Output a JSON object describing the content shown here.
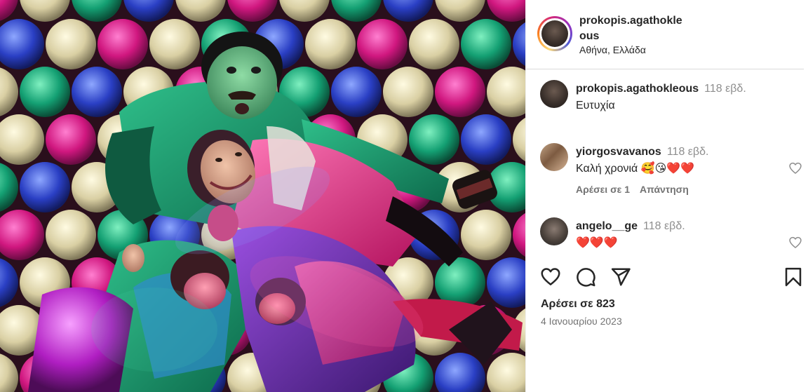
{
  "post": {
    "author": "prokopis.agathokleous",
    "author_line1": "prokopis.agathokle",
    "author_line2": "ous",
    "location": "Αθήνα, Ελλάδα"
  },
  "caption": {
    "user": "prokopis.agathokleous",
    "time": "118 εβδ.",
    "text": "Ευτυχία"
  },
  "comments": [
    {
      "user": "yiorgosvavanos",
      "time": "118 εβδ.",
      "text": "Καλή χρονιά 🥰😘❤️❤️",
      "likes_label": "Αρέσει σε 1",
      "reply_label": "Απάντηση"
    },
    {
      "user": "angelo__ge",
      "time": "118 εβδ.",
      "text": "❤️❤️❤️"
    }
  ],
  "likes": "Αρέσει σε 823",
  "date": "4 Ιανουαρίου 2023",
  "icons": {
    "like": "heart-outline-icon",
    "comment": "speech-bubble-icon",
    "share": "paper-plane-icon",
    "save": "bookmark-icon"
  },
  "colors": {
    "text": "#262626",
    "muted": "#737373",
    "divider": "#dbdbdb"
  }
}
